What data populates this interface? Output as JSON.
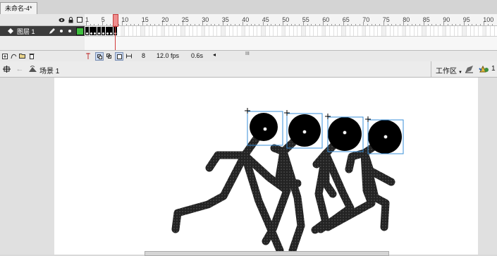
{
  "document_tab": {
    "title": "未命名-4*"
  },
  "timeline": {
    "header_icons": [
      "eye-icon",
      "lock-icon",
      "outline-icon"
    ],
    "ruler_numbers": [
      "1",
      "5",
      "10",
      "15",
      "20",
      "25",
      "30",
      "35",
      "40",
      "45",
      "50",
      "55",
      "60",
      "65",
      "70",
      "75",
      "80",
      "85",
      "90",
      "95",
      "100"
    ],
    "layer": {
      "name": "图层 1",
      "color": "#3fbf3f"
    },
    "keyframes": 8,
    "current_frame": "8",
    "frame_rate": "12.0 fps",
    "elapsed_time": "0.6s",
    "playhead_color": "#d23a3a",
    "scroll_label": "III"
  },
  "editbar": {
    "scene_label": "场景 1",
    "workspace_label": "工作区",
    "workspace_arrow": "▼"
  },
  "stage": {
    "background": "#ffffff",
    "figure_fill": "#262626",
    "selection_color": "#3a8fd8",
    "running_figures": 4
  }
}
